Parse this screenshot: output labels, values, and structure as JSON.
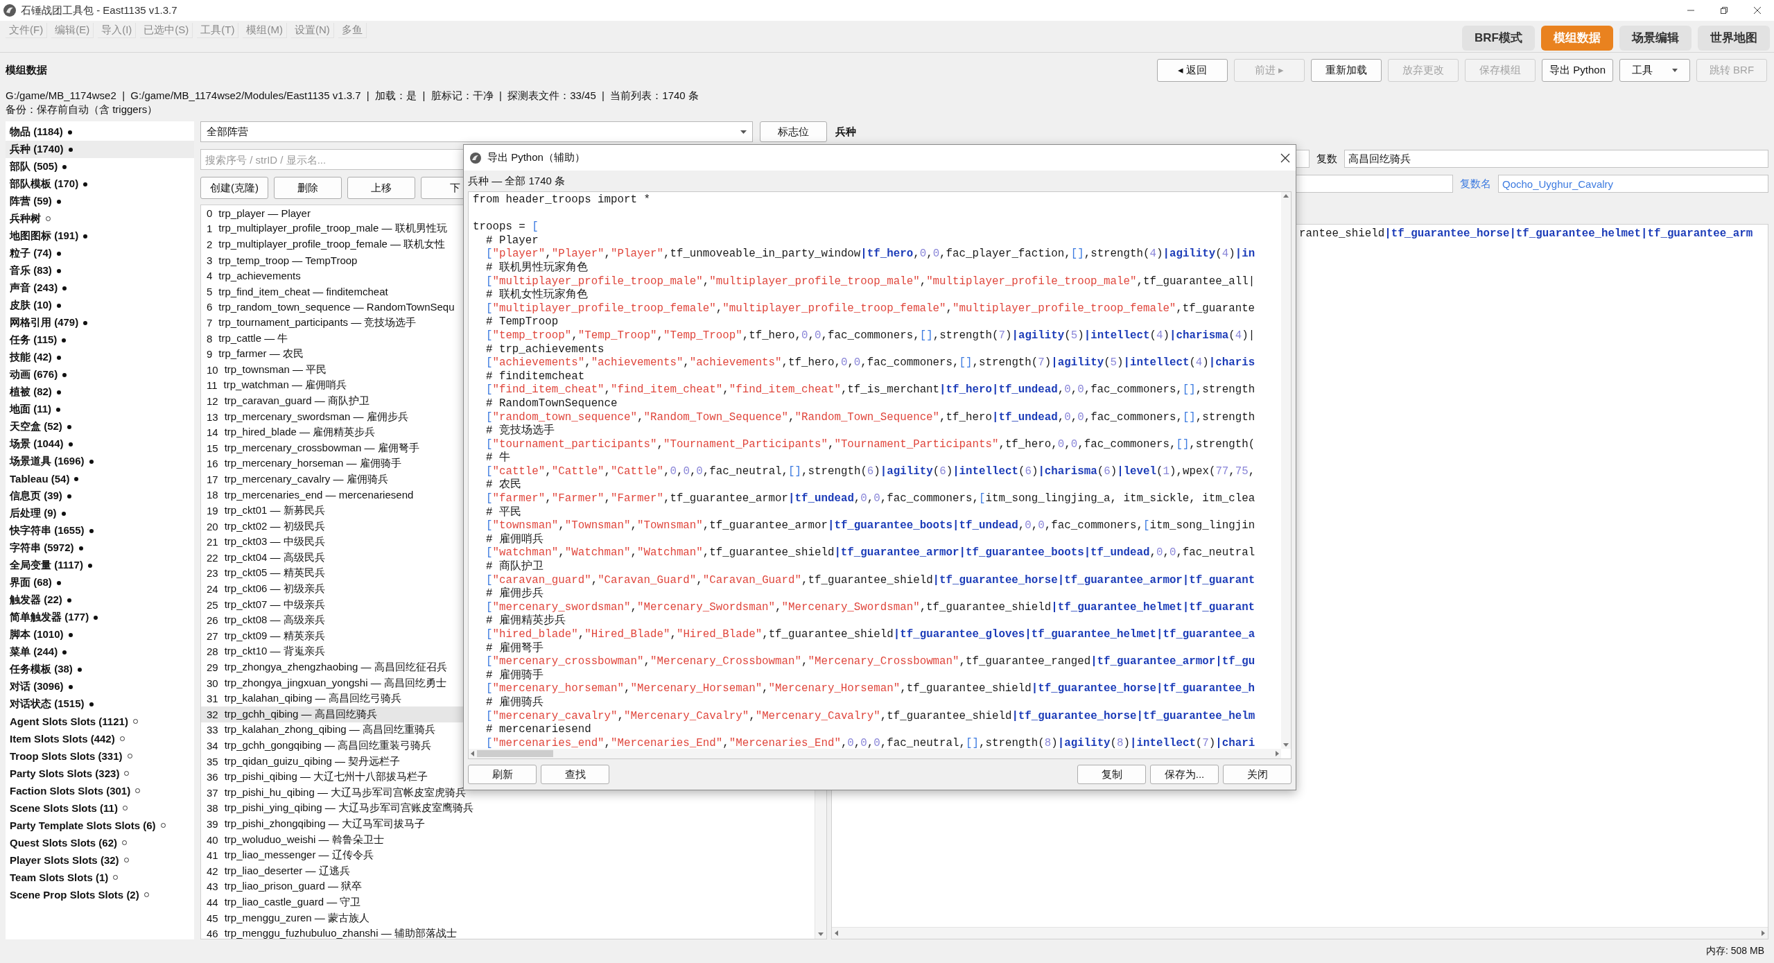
{
  "window": {
    "title": "石锤战团工具包 - East1135 v1.3.7"
  },
  "menu": [
    {
      "label": "文件(F)"
    },
    {
      "label": "编辑(E)"
    },
    {
      "label": "导入(I)"
    },
    {
      "label": "已选中(S)"
    },
    {
      "label": "工具(T)"
    },
    {
      "label": "模组(M)"
    },
    {
      "label": "设置(N)"
    },
    {
      "label": "多鱼"
    }
  ],
  "mode_tabs": [
    {
      "label": "BRF模式",
      "selected": false
    },
    {
      "label": "模组数据",
      "selected": true
    },
    {
      "label": "场景编辑",
      "selected": false
    },
    {
      "label": "世界地图",
      "selected": false
    }
  ],
  "page_title": "模组数据",
  "toolbar": [
    {
      "label": "◂ 返回",
      "kind": "button",
      "disabled": false
    },
    {
      "label": "前进 ▸",
      "kind": "button",
      "disabled": true
    },
    {
      "label": "重新加载",
      "kind": "button",
      "disabled": false
    },
    {
      "label": "放弃更改",
      "kind": "button",
      "disabled": true
    },
    {
      "label": "保存模组",
      "kind": "button",
      "disabled": true
    },
    {
      "label": "导出 Python",
      "kind": "button",
      "disabled": false
    },
    {
      "label": "工具",
      "kind": "dropdown",
      "disabled": false
    },
    {
      "label": "跳转 BRF",
      "kind": "button",
      "disabled": true
    }
  ],
  "info": {
    "path": "G:/game/MB_1174wse2  |  G:/game/MB_1174wse2/Modules/East1135 v1.3.7  |  加载：是  |  脏标记：干净  |  探测表文件：33/45  |  当前列表：1740 条",
    "backup": "备份：保存前自动（含 triggers）"
  },
  "categories": [
    {
      "label": "物品 (1184)",
      "loaded": true,
      "selected": false
    },
    {
      "label": "兵种 (1740)",
      "loaded": true,
      "selected": true
    },
    {
      "label": "部队 (505)",
      "loaded": true,
      "selected": false
    },
    {
      "label": "部队模板 (170)",
      "loaded": true,
      "selected": false
    },
    {
      "label": "阵营 (59)",
      "loaded": true,
      "selected": false
    },
    {
      "label": "兵种树",
      "loaded": false,
      "selected": false
    },
    {
      "label": "地图图标 (191)",
      "loaded": true,
      "selected": false
    },
    {
      "label": "粒子 (74)",
      "loaded": true,
      "selected": false
    },
    {
      "label": "音乐 (83)",
      "loaded": true,
      "selected": false
    },
    {
      "label": "声音 (243)",
      "loaded": true,
      "selected": false
    },
    {
      "label": "皮肤 (10)",
      "loaded": true,
      "selected": false
    },
    {
      "label": "网格引用 (479)",
      "loaded": true,
      "selected": false
    },
    {
      "label": "任务 (115)",
      "loaded": true,
      "selected": false
    },
    {
      "label": "技能 (42)",
      "loaded": true,
      "selected": false
    },
    {
      "label": "动画 (676)",
      "loaded": true,
      "selected": false
    },
    {
      "label": "植被 (82)",
      "loaded": true,
      "selected": false
    },
    {
      "label": "地面 (11)",
      "loaded": true,
      "selected": false
    },
    {
      "label": "天空盒 (52)",
      "loaded": true,
      "selected": false
    },
    {
      "label": "场景 (1044)",
      "loaded": true,
      "selected": false
    },
    {
      "label": "场景道具 (1696)",
      "loaded": true,
      "selected": false
    },
    {
      "label": "Tableau (54)",
      "loaded": true,
      "selected": false
    },
    {
      "label": "信息页 (39)",
      "loaded": true,
      "selected": false
    },
    {
      "label": "后处理 (9)",
      "loaded": true,
      "selected": false
    },
    {
      "label": "快字符串 (1655)",
      "loaded": true,
      "selected": false
    },
    {
      "label": "字符串 (5972)",
      "loaded": true,
      "selected": false
    },
    {
      "label": "全局变量 (1117)",
      "loaded": true,
      "selected": false
    },
    {
      "label": "界面 (68)",
      "loaded": true,
      "selected": false
    },
    {
      "label": "触发器 (22)",
      "loaded": true,
      "selected": false
    },
    {
      "label": "简单触发器 (177)",
      "loaded": true,
      "selected": false
    },
    {
      "label": "脚本 (1010)",
      "loaded": true,
      "selected": false
    },
    {
      "label": "菜单 (244)",
      "loaded": true,
      "selected": false
    },
    {
      "label": "任务模板 (38)",
      "loaded": true,
      "selected": false
    },
    {
      "label": "对话 (3096)",
      "loaded": true,
      "selected": false
    },
    {
      "label": "对话状态 (1515)",
      "loaded": true,
      "selected": false
    },
    {
      "label": "Agent Slots Slots (1121)",
      "loaded": false,
      "selected": false
    },
    {
      "label": "Item Slots Slots (442)",
      "loaded": false,
      "selected": false
    },
    {
      "label": "Troop Slots Slots (331)",
      "loaded": false,
      "selected": false
    },
    {
      "label": "Party Slots Slots (323)",
      "loaded": false,
      "selected": false
    },
    {
      "label": "Faction Slots Slots (301)",
      "loaded": false,
      "selected": false
    },
    {
      "label": "Scene Slots Slots (11)",
      "loaded": false,
      "selected": false
    },
    {
      "label": "Party Template Slots Slots (6)",
      "loaded": false,
      "selected": false
    },
    {
      "label": "Quest Slots Slots (62)",
      "loaded": false,
      "selected": false
    },
    {
      "label": "Player Slots Slots (32)",
      "loaded": false,
      "selected": false
    },
    {
      "label": "Team Slots Slots (1)",
      "loaded": false,
      "selected": false
    },
    {
      "label": "Scene Prop Slots Slots (2)",
      "loaded": false,
      "selected": false
    }
  ],
  "troop_panel": {
    "faction_filter": "全部阵营",
    "flags_button": "标志位",
    "search_placeholder": "搜索序号 / strID / 显示名...",
    "buttons": [
      "创建(克隆)",
      "删除",
      "上移",
      "下"
    ],
    "rows": [
      {
        "index": "0",
        "text": "trp_player — Player",
        "selected": false
      },
      {
        "index": "1",
        "text": "trp_multiplayer_profile_troop_male — 联机男性玩",
        "selected": false
      },
      {
        "index": "2",
        "text": "trp_multiplayer_profile_troop_female — 联机女性",
        "selected": false
      },
      {
        "index": "3",
        "text": "trp_temp_troop — TempTroop",
        "selected": false
      },
      {
        "index": "4",
        "text": "trp_achievements",
        "selected": false
      },
      {
        "index": "5",
        "text": "trp_find_item_cheat — finditemcheat",
        "selected": false
      },
      {
        "index": "6",
        "text": "trp_random_town_sequence — RandomTownSequ",
        "selected": false
      },
      {
        "index": "7",
        "text": "trp_tournament_participants — 竞技场选手",
        "selected": false
      },
      {
        "index": "8",
        "text": "trp_cattle — 牛",
        "selected": false
      },
      {
        "index": "9",
        "text": "trp_farmer — 农民",
        "selected": false
      },
      {
        "index": "10",
        "text": "trp_townsman — 平民",
        "selected": false
      },
      {
        "index": "11",
        "text": "trp_watchman — 雇佣哨兵",
        "selected": false
      },
      {
        "index": "12",
        "text": "trp_caravan_guard — 商队护卫",
        "selected": false
      },
      {
        "index": "13",
        "text": "trp_mercenary_swordsman — 雇佣步兵",
        "selected": false
      },
      {
        "index": "14",
        "text": "trp_hired_blade — 雇佣精英步兵",
        "selected": false
      },
      {
        "index": "15",
        "text": "trp_mercenary_crossbowman — 雇佣弩手",
        "selected": false
      },
      {
        "index": "16",
        "text": "trp_mercenary_horseman — 雇佣骑手",
        "selected": false
      },
      {
        "index": "17",
        "text": "trp_mercenary_cavalry — 雇佣骑兵",
        "selected": false
      },
      {
        "index": "18",
        "text": "trp_mercenaries_end — mercenariesend",
        "selected": false
      },
      {
        "index": "19",
        "text": "trp_ckt01 — 新募民兵",
        "selected": false
      },
      {
        "index": "20",
        "text": "trp_ckt02 — 初级民兵",
        "selected": false
      },
      {
        "index": "21",
        "text": "trp_ckt03 — 中级民兵",
        "selected": false
      },
      {
        "index": "22",
        "text": "trp_ckt04 — 高级民兵",
        "selected": false
      },
      {
        "index": "23",
        "text": "trp_ckt05 — 精英民兵",
        "selected": false
      },
      {
        "index": "24",
        "text": "trp_ckt06 — 初级亲兵",
        "selected": false
      },
      {
        "index": "25",
        "text": "trp_ckt07 — 中级亲兵",
        "selected": false
      },
      {
        "index": "26",
        "text": "trp_ckt08 — 高级亲兵",
        "selected": false
      },
      {
        "index": "27",
        "text": "trp_ckt09 — 精英亲兵",
        "selected": false
      },
      {
        "index": "28",
        "text": "trp_ckt10 — 背嵬亲兵",
        "selected": false
      },
      {
        "index": "29",
        "text": "trp_zhongya_zhengzhaobing — 高昌回纥征召兵",
        "selected": false
      },
      {
        "index": "30",
        "text": "trp_zhongya_jingxuan_yongshi — 高昌回纥勇士",
        "selected": false
      },
      {
        "index": "31",
        "text": "trp_kalahan_qibing — 高昌回纥弓骑兵",
        "selected": false
      },
      {
        "index": "32",
        "text": "trp_gchh_qibing — 高昌回纥骑兵",
        "selected": true
      },
      {
        "index": "33",
        "text": "trp_kalahan_zhong_qibing — 高昌回纥重骑兵",
        "selected": false
      },
      {
        "index": "34",
        "text": "trp_gchh_gongqibing — 高昌回纥重装弓骑兵",
        "selected": false
      },
      {
        "index": "35",
        "text": "trp_qidan_guizu_qibing — 契丹远栏子",
        "selected": false
      },
      {
        "index": "36",
        "text": "trp_pishi_qibing — 大辽七州十八部拔马栏子",
        "selected": false
      },
      {
        "index": "37",
        "text": "trp_pishi_hu_qibing — 大辽马步军司宫帐皮室虎骑兵",
        "selected": false
      },
      {
        "index": "38",
        "text": "trp_pishi_ying_qibing — 大辽马步军司宫账皮室鹰骑兵",
        "selected": false
      },
      {
        "index": "39",
        "text": "trp_pishi_zhongqibing — 大辽马军司拔马子",
        "selected": false
      },
      {
        "index": "40",
        "text": "trp_woluduo_weishi — 斡鲁朵卫士",
        "selected": false
      },
      {
        "index": "41",
        "text": "trp_liao_messenger — 辽传令兵",
        "selected": false
      },
      {
        "index": "42",
        "text": "trp_liao_deserter — 辽逃兵",
        "selected": false
      },
      {
        "index": "43",
        "text": "trp_liao_prison_guard — 狱卒",
        "selected": false
      },
      {
        "index": "44",
        "text": "trp_liao_castle_guard — 守卫",
        "selected": false
      },
      {
        "index": "45",
        "text": "trp_menggu_zuren — 蒙古族人",
        "selected": false
      },
      {
        "index": "46",
        "text": "trp_menggu_fuzhubuluo_zhanshi — 辅助部落战士",
        "selected": false
      }
    ]
  },
  "detail": {
    "heading": "兵种",
    "plural_label": "复数",
    "plural_value": "高昌回纥骑兵",
    "plural_name_label": "复数名",
    "plural_name_value": "Qocho_Uyghur_Cavalry",
    "code_line": "rantee_shield|tf_guarantee_horse|tf_guarantee_helmet|tf_guarantee_arm"
  },
  "dialog": {
    "title": "导出 Python（辅助）",
    "subtitle": "兵种 — 全部 1740 条",
    "code": [
      {
        "kind": "statement",
        "text": "from header_troops import *"
      },
      {
        "kind": "blank"
      },
      {
        "kind": "statement",
        "text": "troops = ["
      },
      {
        "kind": "comment",
        "text": "# Player"
      },
      {
        "kind": "entry",
        "text": "[\"player\",\"Player\",\"Player\",tf_unmoveable_in_party_window|tf_hero,0,0,fac_player_faction,[],strength(4)|agility(4)|in"
      },
      {
        "kind": "comment",
        "text": "# 联机男性玩家角色"
      },
      {
        "kind": "entry",
        "text": "[\"multiplayer_profile_troop_male\",\"multiplayer_profile_troop_male\",\"multiplayer_profile_troop_male\",tf_guarantee_all|"
      },
      {
        "kind": "comment",
        "text": "# 联机女性玩家角色"
      },
      {
        "kind": "entry",
        "text": "[\"multiplayer_profile_troop_female\",\"multiplayer_profile_troop_female\",\"multiplayer_profile_troop_female\",tf_guarante"
      },
      {
        "kind": "comment",
        "text": "# TempTroop"
      },
      {
        "kind": "entry",
        "text": "[\"temp_troop\",\"Temp_Troop\",\"Temp_Troop\",tf_hero,0,0,fac_commoners,[],strength(7)|agility(5)|intellect(4)|charisma(4)|"
      },
      {
        "kind": "comment",
        "text": "# trp_achievements"
      },
      {
        "kind": "entry",
        "text": "[\"achievements\",\"achievements\",\"achievements\",tf_hero,0,0,fac_commoners,[],strength(7)|agility(5)|intellect(4)|charis"
      },
      {
        "kind": "comment",
        "text": "# finditemcheat"
      },
      {
        "kind": "entry",
        "text": "[\"find_item_cheat\",\"find_item_cheat\",\"find_item_cheat\",tf_is_merchant|tf_hero|tf_undead,0,0,fac_commoners,[],strength"
      },
      {
        "kind": "comment",
        "text": "# RandomTownSequence"
      },
      {
        "kind": "entry",
        "text": "[\"random_town_sequence\",\"Random_Town_Sequence\",\"Random_Town_Sequence\",tf_hero|tf_undead,0,0,fac_commoners,[],strength"
      },
      {
        "kind": "comment",
        "text": "# 竞技场选手"
      },
      {
        "kind": "entry",
        "text": "[\"tournament_participants\",\"Tournament_Participants\",\"Tournament_Participants\",tf_hero,0,0,fac_commoners,[],strength("
      },
      {
        "kind": "comment",
        "text": "# 牛"
      },
      {
        "kind": "entry",
        "text": "[\"cattle\",\"Cattle\",\"Cattle\",0,0,0,fac_neutral,[],strength(6)|agility(6)|intellect(6)|charisma(6)|level(1),wpex(77,75,"
      },
      {
        "kind": "comment",
        "text": "# 农民"
      },
      {
        "kind": "entry",
        "text": "[\"farmer\",\"Farmer\",\"Farmer\",tf_guarantee_armor|tf_undead,0,0,fac_commoners,[itm_song_lingjing_a, itm_sickle, itm_clea"
      },
      {
        "kind": "comment",
        "text": "# 平民"
      },
      {
        "kind": "entry",
        "text": "[\"townsman\",\"Townsman\",\"Townsman\",tf_guarantee_armor|tf_guarantee_boots|tf_undead,0,0,fac_commoners,[itm_song_lingjin"
      },
      {
        "kind": "comment",
        "text": "# 雇佣哨兵"
      },
      {
        "kind": "entry",
        "text": "[\"watchman\",\"Watchman\",\"Watchman\",tf_guarantee_shield|tf_guarantee_armor|tf_guarantee_boots|tf_undead,0,0,fac_neutral"
      },
      {
        "kind": "comment",
        "text": "# 商队护卫"
      },
      {
        "kind": "entry",
        "text": "[\"caravan_guard\",\"Caravan_Guard\",\"Caravan_Guard\",tf_guarantee_shield|tf_guarantee_horse|tf_guarantee_armor|tf_guarant"
      },
      {
        "kind": "comment",
        "text": "# 雇佣步兵"
      },
      {
        "kind": "entry",
        "text": "[\"mercenary_swordsman\",\"Mercenary_Swordsman\",\"Mercenary_Swordsman\",tf_guarantee_shield|tf_guarantee_helmet|tf_guarant"
      },
      {
        "kind": "comment",
        "text": "# 雇佣精英步兵"
      },
      {
        "kind": "entry",
        "text": "[\"hired_blade\",\"Hired_Blade\",\"Hired_Blade\",tf_guarantee_shield|tf_guarantee_gloves|tf_guarantee_helmet|tf_guarantee_a"
      },
      {
        "kind": "comment",
        "text": "# 雇佣弩手"
      },
      {
        "kind": "entry",
        "text": "[\"mercenary_crossbowman\",\"Mercenary_Crossbowman\",\"Mercenary_Crossbowman\",tf_guarantee_ranged|tf_guarantee_armor|tf_gu"
      },
      {
        "kind": "comment",
        "text": "# 雇佣骑手"
      },
      {
        "kind": "entry",
        "text": "[\"mercenary_horseman\",\"Mercenary_Horseman\",\"Mercenary_Horseman\",tf_guarantee_shield|tf_guarantee_horse|tf_guarantee_h"
      },
      {
        "kind": "comment",
        "text": "# 雇佣骑兵"
      },
      {
        "kind": "entry",
        "text": "[\"mercenary_cavalry\",\"Mercenary_Cavalry\",\"Mercenary_Cavalry\",tf_guarantee_shield|tf_guarantee_horse|tf_guarantee_helm"
      },
      {
        "kind": "comment",
        "text": "# mercenariesend"
      },
      {
        "kind": "entry",
        "text": "[\"mercenaries_end\",\"Mercenaries_End\",\"Mercenaries_End\",0,0,0,fac_neutral,[],strength(8)|agility(8)|intellect(7)|chari"
      }
    ],
    "left_buttons": [
      "刷新",
      "查找"
    ],
    "right_buttons": [
      "复制",
      "保存为...",
      "关闭"
    ]
  },
  "status_bar": {
    "memory": "内存: 508 MB"
  }
}
